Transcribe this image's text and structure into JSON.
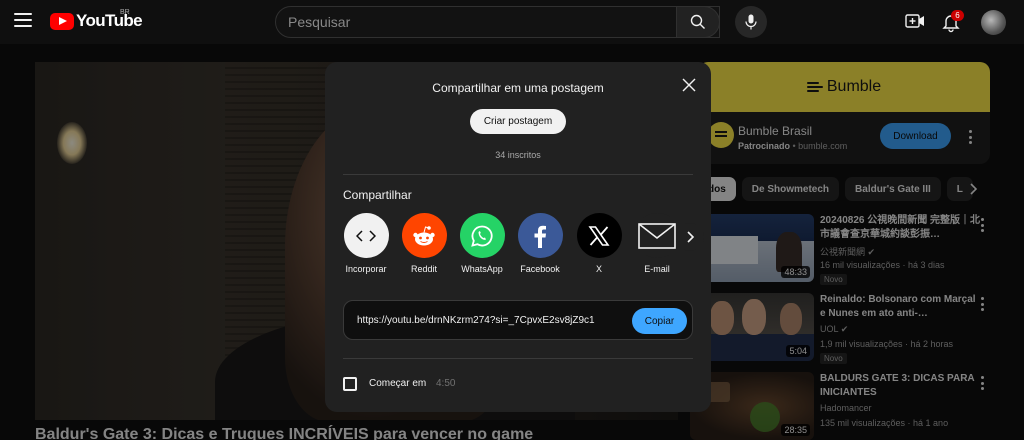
{
  "header": {
    "logo_text": "YouTube",
    "country_code": "BR",
    "search_placeholder": "Pesquisar",
    "notification_count": "6"
  },
  "video": {
    "title": "Baldur's Gate 3: Dicas e Truques INCRÍVEIS para vencer no game"
  },
  "ad": {
    "brand_banner": "Bumble",
    "name": "Bumble Brasil",
    "sponsored_label": "Patrocinado",
    "domain": "bumble.com",
    "cta": "Download"
  },
  "chips": [
    "dos",
    "De Showmetech",
    "Baldur's Gate III",
    "L"
  ],
  "recommendations": [
    {
      "title": "20240826 公視晚間新聞 完整版｜北市議會查京華城約談彭振…",
      "channel": "公視新聞網",
      "meta": "16 mil visualizações · há 3 dias",
      "badge": "Novo",
      "duration": "48:33"
    },
    {
      "title": "Reinaldo: Bolsonaro com Marçal e Nunes em ato anti-…",
      "channel": "UOL",
      "meta": "1,9 mil visualizações · há 2 horas",
      "badge": "Novo",
      "duration": "5:04"
    },
    {
      "title": "BALDURS GATE 3: DICAS PARA INICIANTES",
      "channel": "Hadomancer",
      "meta": "135 mil visualizações · há 1 ano",
      "badge": "",
      "duration": "28:35"
    }
  ],
  "modal": {
    "title": "Compartilhar em uma postagem",
    "create_post": "Criar postagem",
    "subscribers": "34 inscritos",
    "share_label": "Compartilhar",
    "targets": [
      {
        "name": "Incorporar",
        "icon": "embed-icon",
        "color": "#f1f1f1"
      },
      {
        "name": "Reddit",
        "icon": "reddit-icon",
        "color": "#ff4500"
      },
      {
        "name": "WhatsApp",
        "icon": "whatsapp-icon",
        "color": "#25d366"
      },
      {
        "name": "Facebook",
        "icon": "facebook-icon",
        "color": "#3b5998"
      },
      {
        "name": "X",
        "icon": "x-icon",
        "color": "#000000"
      },
      {
        "name": "E-mail",
        "icon": "email-icon",
        "color": "#212121"
      }
    ],
    "url": "https://youtu.be/drnNKzrm274?si=_7CpvxE2sv8jZ9c1",
    "copy": "Copiar",
    "start_at_label": "Começar em",
    "start_at_time": "4:50"
  },
  "colors": {
    "accent_blue": "#3ea6ff",
    "brand_red": "#ff0000",
    "bumble_yellow": "#fde94a"
  }
}
